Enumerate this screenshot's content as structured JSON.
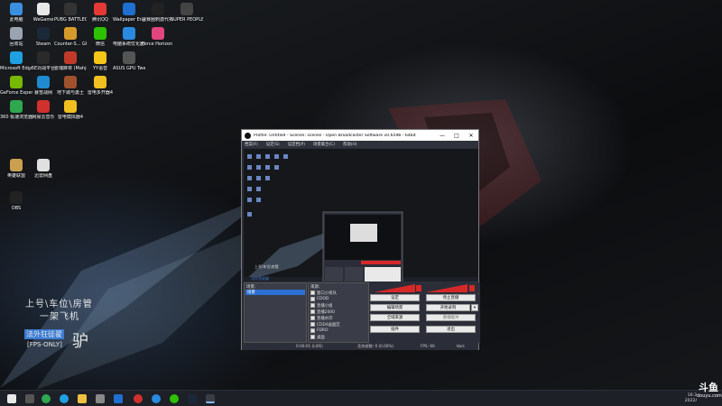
{
  "desktop": {
    "icons": [
      {
        "label": "此电脑",
        "color": "#3b8fe0"
      },
      {
        "label": "WeGame",
        "color": "#e8e8e8"
      },
      {
        "label": "PUBG BATTLEGR...",
        "color": "#333333"
      },
      {
        "label": "腾讯QQ",
        "color": "#e53935"
      },
      {
        "label": "Wallpaper Engine: ...",
        "color": "#1e6fd0"
      },
      {
        "label": "决赛圈刺激代补手",
        "color": "#222222"
      },
      {
        "label": "SUPER PEOPLE CBT",
        "color": "#444444"
      },
      {
        "label": "回收站",
        "color": "#9aa4b0"
      },
      {
        "label": "Steam",
        "color": "#1b2838"
      },
      {
        "label": "Counter-S... Global Off...",
        "color": "#d49b2a"
      },
      {
        "label": "微信",
        "color": "#2dc100"
      },
      {
        "label": "电脑系统优化器8.0",
        "color": "#2a8ae0"
      },
      {
        "label": "Force Horizon 5",
        "color": "#e0457b"
      },
      {
        "label": "Microsoft Edge",
        "color": "#1fa0e0"
      },
      {
        "label": "5E对战平台",
        "color": "#2a2a2a"
      },
      {
        "label": "雀魂麻将 (Mahjong...",
        "color": "#c0392b"
      },
      {
        "label": "YY语音",
        "color": "#f5c518"
      },
      {
        "label": "ASUS GPU TweakII",
        "color": "#555555"
      },
      {
        "label": "GeForce Experience",
        "color": "#76b900"
      },
      {
        "label": "暴雪战网",
        "color": "#1f8ad0"
      },
      {
        "label": "地下城与勇士",
        "color": "#a0522d"
      },
      {
        "label": "雷电多开器4",
        "color": "#f0c020"
      },
      {
        "label": "360 极速浏览器X",
        "color": "#2fa84f"
      },
      {
        "label": "网易云音乐",
        "color": "#d0312d"
      },
      {
        "label": "雷电模拟器4",
        "color": "#f0c020"
      },
      {
        "label": "英雄联盟",
        "color": "#c8a050"
      },
      {
        "label": "迅雷网盘",
        "color": "#e0e0e0"
      },
      {
        "label": "OBS",
        "color": "#222222"
      }
    ]
  },
  "overlay": {
    "line1": "上号\\车位\\房管",
    "line2": "一架飞机",
    "tag": "法外狂徒翟",
    "fps": "[FPS-ONLY]",
    "glyph": "驴"
  },
  "obs": {
    "title": "Profile: Untitled - Scenes: scenes - Open Broadcaster Software v0.659b - 64bit",
    "menu": [
      "档案(F)",
      "设定(S)",
      "设定档(P)",
      "场景集合(C)",
      "帮助(H)"
    ],
    "scenes_header": "场景:",
    "scenes": [
      "场景"
    ],
    "sources_header": "来源:",
    "sources": [
      "窗口小排队",
      "CDOD",
      "直播小组",
      "直播2000",
      "直播水印",
      "CDD4画面区",
      "FDRO",
      "桌面"
    ],
    "buttons": {
      "settings": "设定",
      "stop_stream": "停止直播",
      "edit_scene": "编辑场景",
      "start_record": "开始录制",
      "global_sources": "全域来源",
      "replay_buffer": "重播缓冲",
      "plugins": "插件",
      "exit": "退出"
    },
    "status": {
      "timecode": "0:00:01 (LIVE)",
      "dropped": "丢失帧数: 0 (0.00%)",
      "fps": "FPS: 60",
      "bitrate": "kb/s"
    }
  },
  "tray": {
    "time": "16:3",
    "date": "2022/"
  },
  "watermark": {
    "main": "斗鱼",
    "sub": "douyu.com"
  },
  "colors": {
    "obs_bg": "#2b2e38",
    "meter_red": "#d62828",
    "accent_blue": "#2d6fd2"
  }
}
